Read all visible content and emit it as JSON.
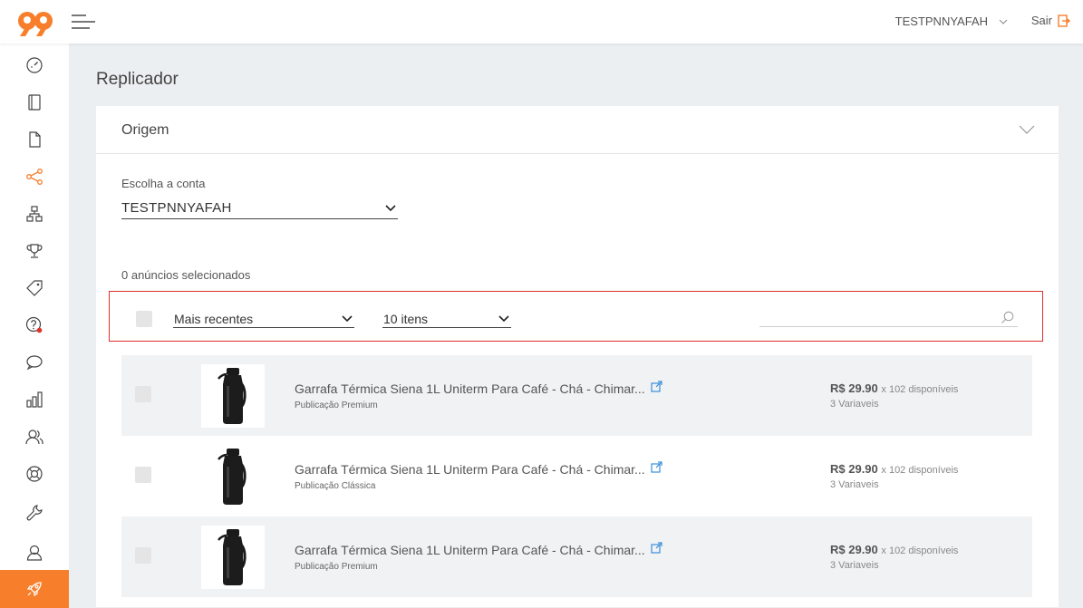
{
  "header": {
    "user_name": "TESTPNNYAFAH",
    "logout_label": "Sair"
  },
  "colors": {
    "accent": "#f77f2c",
    "highlight_border": "#e0312b",
    "link": "#3a8fd8"
  },
  "sidebar": {
    "items": [
      {
        "icon": "speedometer-icon"
      },
      {
        "icon": "notebook-icon"
      },
      {
        "icon": "document-icon"
      },
      {
        "icon": "share-icon",
        "active": true
      },
      {
        "icon": "hierarchy-icon"
      },
      {
        "icon": "trophy-icon"
      },
      {
        "icon": "tag-icon"
      },
      {
        "icon": "question-notification-icon"
      },
      {
        "icon": "chat-bubble-icon"
      },
      {
        "icon": "bar-chart-icon"
      },
      {
        "icon": "users-icon"
      },
      {
        "icon": "lifebuoy-icon"
      },
      {
        "icon": "wrench-icon"
      },
      {
        "icon": "user-icon"
      },
      {
        "icon": "rocket-icon",
        "highlighted": true
      }
    ]
  },
  "page": {
    "title": "Replicador"
  },
  "origin": {
    "title": "Origem",
    "account_label": "Escolha a conta",
    "account_value": "TESTPNNYAFAH",
    "selected_count": "0 anúncios selecionados",
    "sort_value": "Mais recentes",
    "per_page_value": "10 itens",
    "search_placeholder": ""
  },
  "listings": [
    {
      "title": "Garrafa Térmica Siena 1L Uniterm Para Café - Chá - Chimar...",
      "type": "Publicação Premium",
      "price": "R$ 29.90",
      "quantity": "x 102 disponíveis",
      "variants": "3 Variaveis"
    },
    {
      "title": "Garrafa Térmica Siena 1L Uniterm Para Café - Chá - Chimar...",
      "type": "Publicação Clássica",
      "price": "R$ 29.90",
      "quantity": "x 102 disponíveis",
      "variants": "3 Variaveis"
    },
    {
      "title": "Garrafa Térmica Siena 1L Uniterm Para Café - Chá - Chimar...",
      "type": "Publicação Premium",
      "price": "R$ 29.90",
      "quantity": "x 102 disponíveis",
      "variants": "3 Variaveis"
    }
  ]
}
